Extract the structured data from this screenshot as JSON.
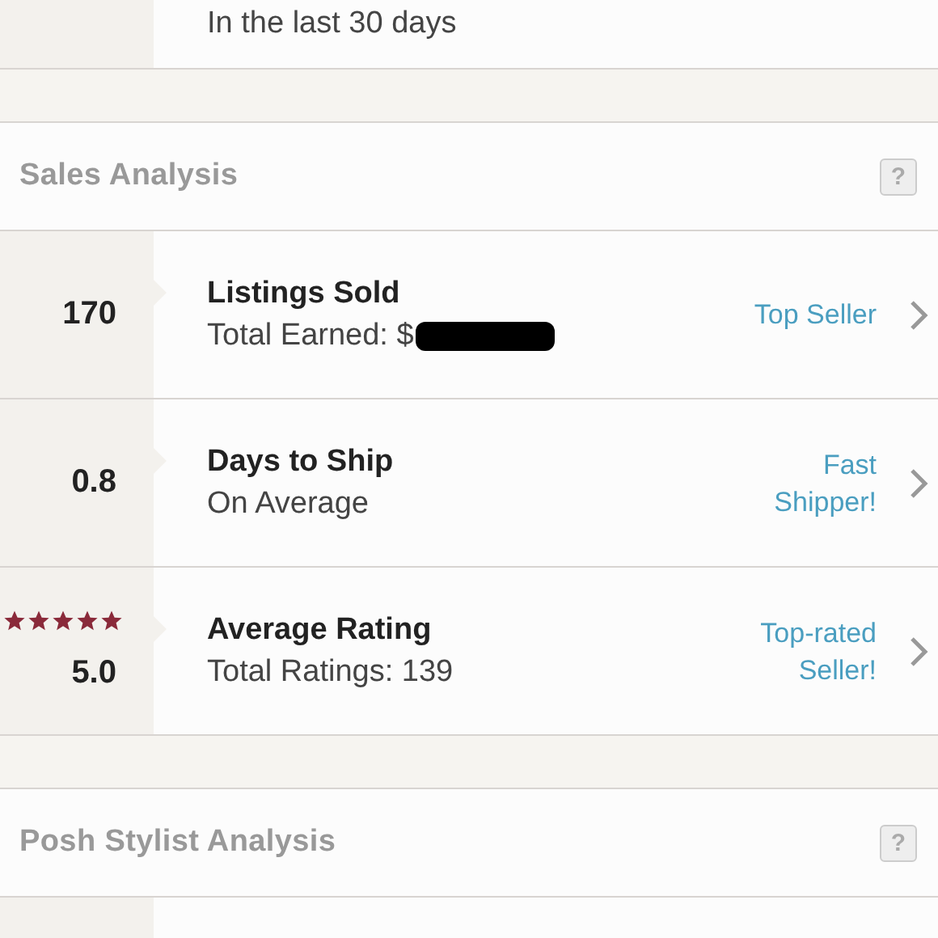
{
  "top_row": {
    "subtitle": "In the last 30 days"
  },
  "sections": [
    {
      "title": "Sales Analysis",
      "help": "?",
      "rows": [
        {
          "value": "170",
          "title": "Listings Sold",
          "subtitle": "Total Earned: $",
          "redacted": true,
          "badge": [
            "Top Seller"
          ]
        },
        {
          "value": "0.8",
          "title": "Days to Ship",
          "subtitle": "On Average",
          "redacted": false,
          "badge": [
            "Fast",
            "Shipper!"
          ]
        },
        {
          "value": "5.0",
          "stars": 5,
          "title": "Average Rating",
          "subtitle": "Total Ratings: 139",
          "redacted": false,
          "badge": [
            "Top-rated",
            "Seller!"
          ]
        }
      ]
    },
    {
      "title": "Posh Stylist Analysis",
      "help": "?"
    }
  ]
}
